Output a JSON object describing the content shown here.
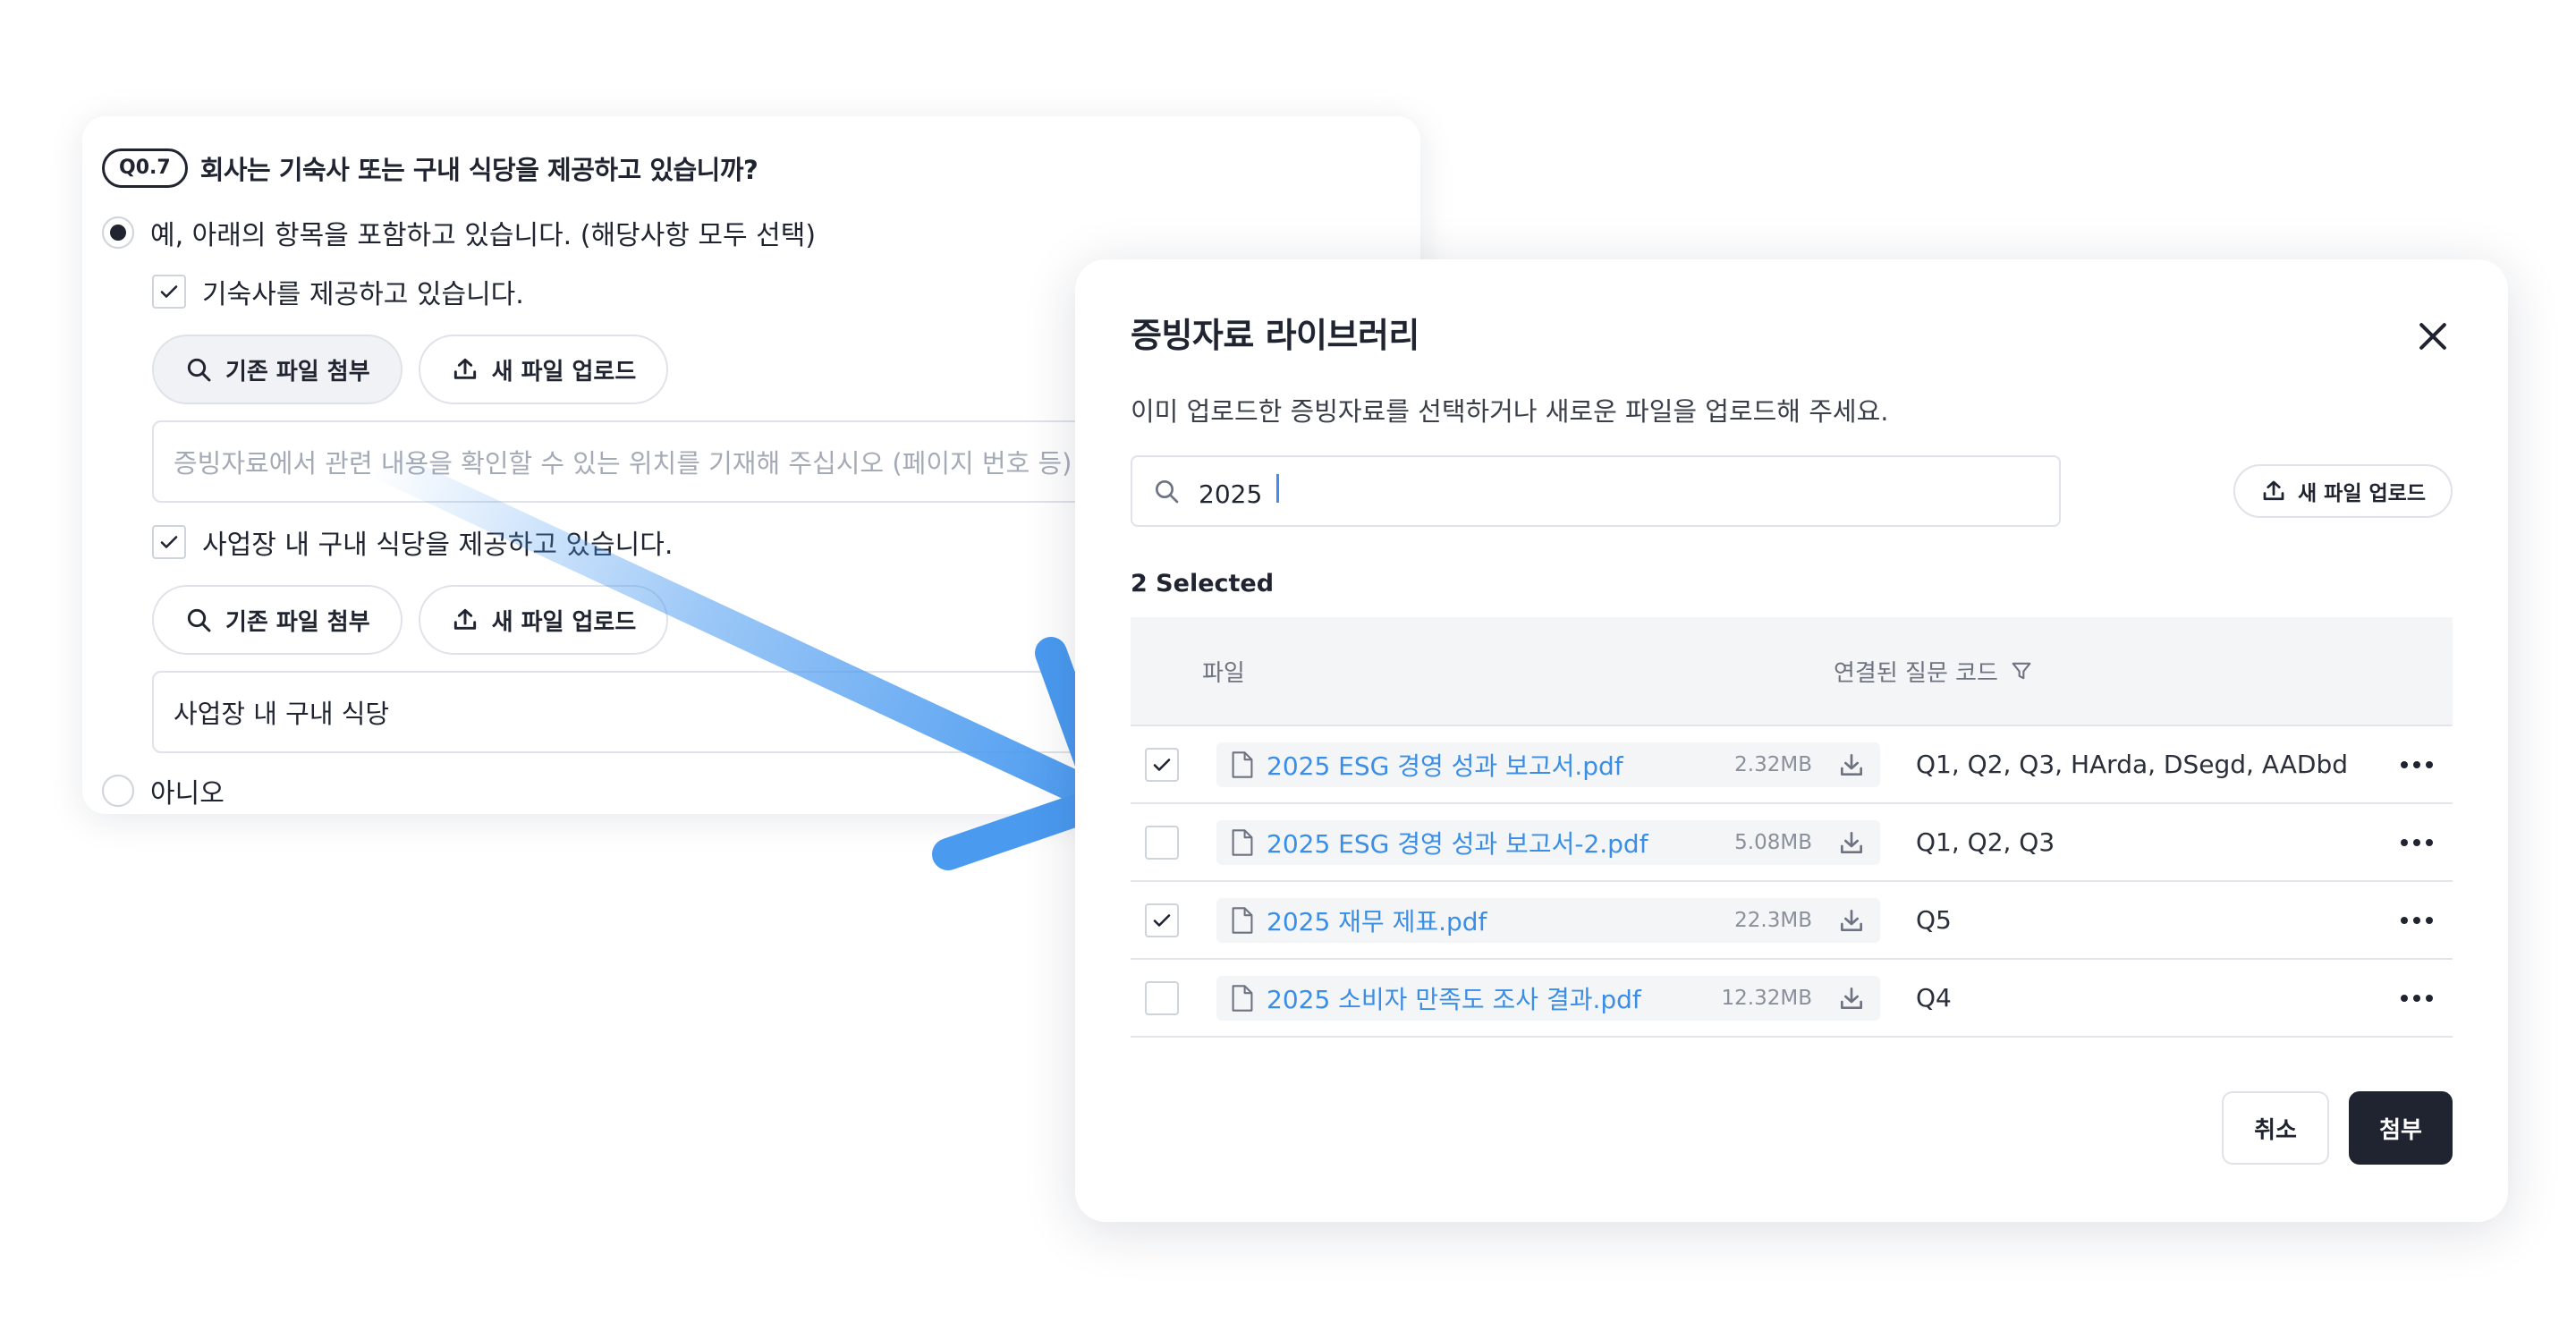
{
  "question": {
    "code": "Q0.7",
    "title": "회사는 기숙사 또는 구내 식당을 제공하고 있습니까?",
    "option_yes": "예, 아래의 항목을 포함하고 있습니다. (해당사항 모두 선택)",
    "option_no": "아니오",
    "items": [
      {
        "label": "기숙사를 제공하고 있습니다.",
        "checked": true,
        "btn_existing": "기존 파일 첨부",
        "btn_new": "새 파일 업로드",
        "note_placeholder": "증빙자료에서 관련 내용을 확인할 수 있는 위치를 기재해 주십시오 (페이지 번호 등)",
        "note_value": ""
      },
      {
        "label": "사업장 내 구내 식당을 제공하고 있습니다.",
        "checked": true,
        "btn_existing": "기존 파일 첨부",
        "btn_new": "새 파일 업로드",
        "note_placeholder": "",
        "note_value": "사업장 내 구내 식당"
      }
    ]
  },
  "modal": {
    "title": "증빙자료 라이브러리",
    "description": "이미 업로드한 증빙자료를 선택하거나 새로운 파일을 업로드해 주세요.",
    "search_value": "2025",
    "upload_label": "새 파일 업로드",
    "selected_text": "2 Selected",
    "columns": {
      "file": "파일",
      "codes": "연결된 질문 코드"
    },
    "files": [
      {
        "name": "2025 ESG 경영 성과 보고서.pdf",
        "size": "2.32MB",
        "codes": "Q1, Q2, Q3, HArda, DSegd, AADbd",
        "checked": true
      },
      {
        "name": "2025 ESG 경영 성과 보고서-2.pdf",
        "size": "5.08MB",
        "codes": "Q1, Q2, Q3",
        "checked": false
      },
      {
        "name": "2025 재무 제표.pdf",
        "size": "22.3MB",
        "codes": "Q5",
        "checked": true
      },
      {
        "name": "2025 소비자 만족도 조사 결과.pdf",
        "size": "12.32MB",
        "codes": "Q4",
        "checked": false
      }
    ],
    "cancel_label": "취소",
    "attach_label": "첨부"
  },
  "colors": {
    "accent": "#3a8ee6",
    "dark": "#1f2430",
    "arrow": "#4a9af0"
  }
}
